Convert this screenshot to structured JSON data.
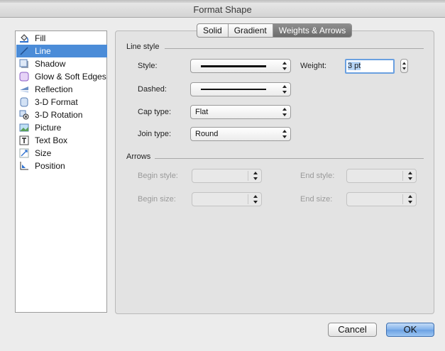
{
  "window": {
    "title": "Format Shape"
  },
  "sidebar": {
    "items": [
      {
        "label": "Fill",
        "icon": "paint-bucket-icon",
        "selected": false
      },
      {
        "label": "Line",
        "icon": "line-icon",
        "selected": true
      },
      {
        "label": "Shadow",
        "icon": "shadow-icon",
        "selected": false
      },
      {
        "label": "Glow & Soft Edges",
        "icon": "glow-icon",
        "selected": false
      },
      {
        "label": "Reflection",
        "icon": "reflection-icon",
        "selected": false
      },
      {
        "label": "3-D Format",
        "icon": "3d-format-icon",
        "selected": false
      },
      {
        "label": "3-D Rotation",
        "icon": "3d-rotation-icon",
        "selected": false
      },
      {
        "label": "Picture",
        "icon": "picture-icon",
        "selected": false
      },
      {
        "label": "Text Box",
        "icon": "text-box-icon",
        "selected": false
      },
      {
        "label": "Size",
        "icon": "size-icon",
        "selected": false
      },
      {
        "label": "Position",
        "icon": "position-icon",
        "selected": false
      }
    ]
  },
  "tabs": [
    {
      "label": "Solid",
      "active": false
    },
    {
      "label": "Gradient",
      "active": false
    },
    {
      "label": "Weights & Arrows",
      "active": true
    }
  ],
  "line_style": {
    "group_title": "Line style",
    "style_label": "Style:",
    "weight_label": "Weight:",
    "weight_value": "3 pt",
    "dashed_label": "Dashed:",
    "cap_type_label": "Cap type:",
    "cap_type_value": "Flat",
    "join_type_label": "Join type:",
    "join_type_value": "Round"
  },
  "arrows": {
    "group_title": "Arrows",
    "begin_style_label": "Begin style:",
    "end_style_label": "End style:",
    "begin_size_label": "Begin size:",
    "end_size_label": "End size:"
  },
  "buttons": {
    "cancel": "Cancel",
    "ok": "OK"
  },
  "colors": {
    "selection": "#4b8cd8",
    "default_button": "#6aa0e3"
  }
}
